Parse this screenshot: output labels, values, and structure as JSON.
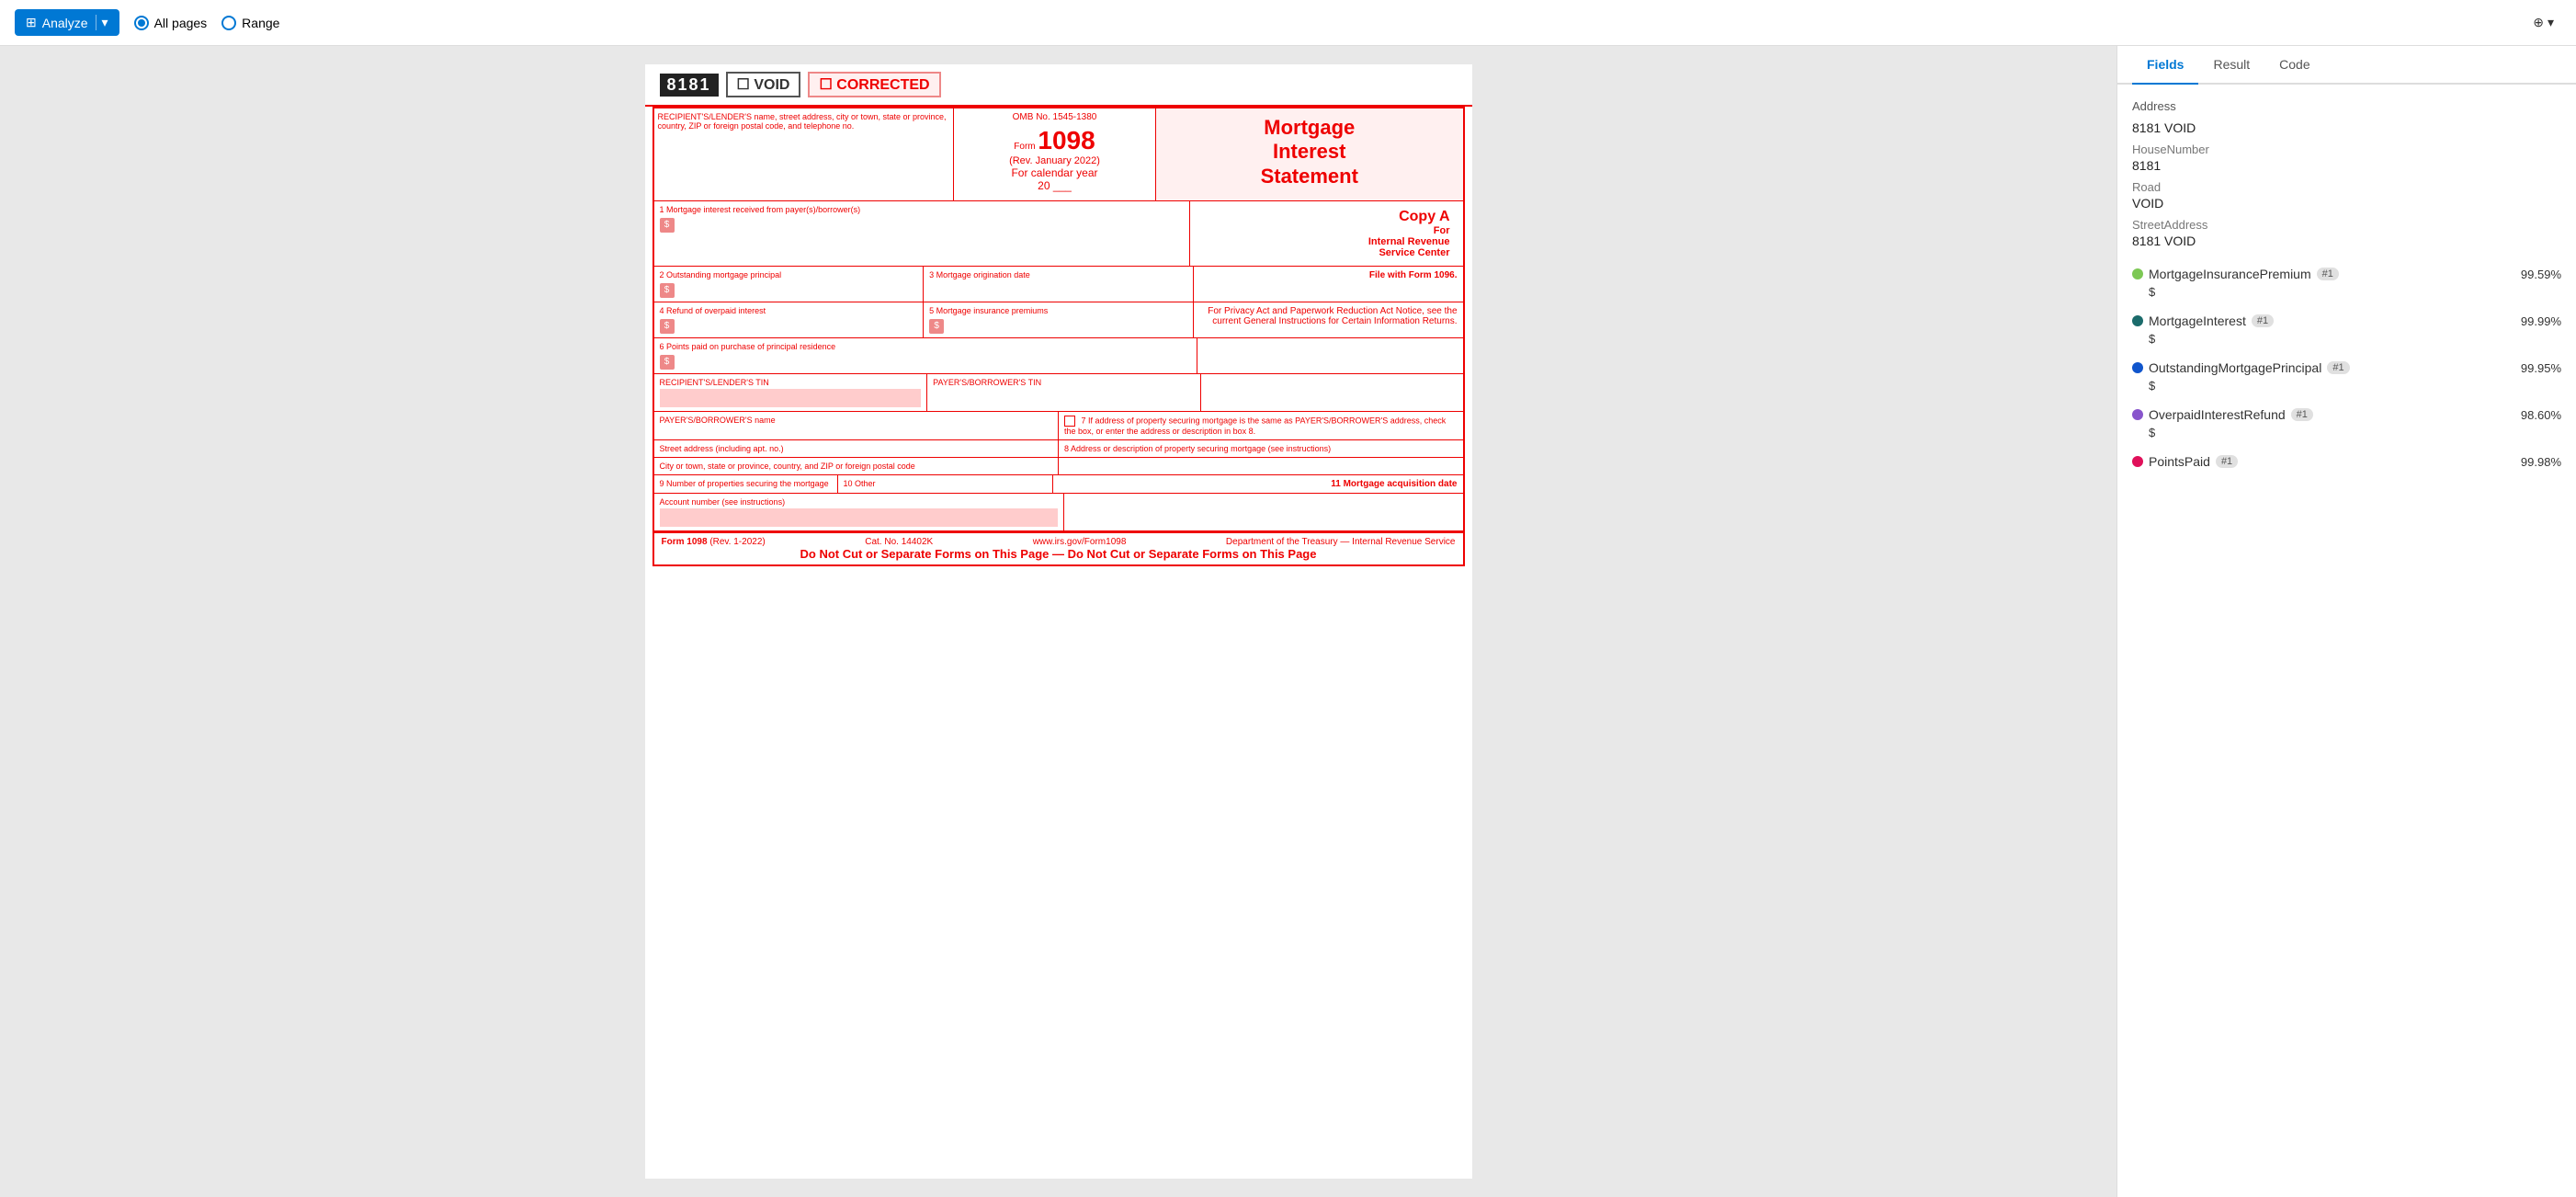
{
  "toolbar": {
    "analyze_label": "Analyze",
    "all_pages_label": "All pages",
    "range_label": "Range",
    "layers_label": "⊕"
  },
  "panel": {
    "tabs": [
      "Fields",
      "Result",
      "Code"
    ],
    "active_tab": "Fields",
    "address_section_label": "Address",
    "address_fields": [
      {
        "label": "8181 VOID"
      },
      {
        "sub_label": "HouseNumber",
        "value": "8181"
      },
      {
        "sub_label": "Road",
        "value": "VOID"
      },
      {
        "sub_label": "StreetAddress",
        "value": "8181 VOID"
      }
    ],
    "fields": [
      {
        "name": "MortgageInsurancePremium",
        "badge": "#1",
        "dot_color": "#7dc855",
        "confidence": "99.59%",
        "value": "$"
      },
      {
        "name": "MortgageInterest",
        "badge": "#1",
        "dot_color": "#1b6b6b",
        "confidence": "99.99%",
        "value": "$"
      },
      {
        "name": "OutstandingMortgagePrincipal",
        "badge": "#1",
        "dot_color": "#1055cc",
        "confidence": "99.95%",
        "value": "$"
      },
      {
        "name": "OverpaidInterestRefund",
        "badge": "#1",
        "dot_color": "#8855cc",
        "confidence": "98.60%",
        "value": "$"
      },
      {
        "name": "PointsPaid",
        "badge": "#1",
        "dot_color": "#e0105a",
        "confidence": "99.98%",
        "value": ""
      }
    ]
  },
  "form": {
    "form_number_box": "8181",
    "void_label": "VOID",
    "corrected_label": "CORRECTED",
    "omb": "OMB No. 1545-1380",
    "form_name": "1098",
    "rev": "(Rev. January 2022)",
    "calendar_label": "For calendar year",
    "calendar_year": "20 ___",
    "title_line1": "Mortgage",
    "title_line2": "Interest",
    "title_line3": "Statement",
    "copy_a_label": "Copy A",
    "copy_a_sub": "For",
    "copy_a_irs": "Internal Revenue",
    "copy_a_sc": "Service Center",
    "file_with": "File with Form 1096.",
    "privacy_text": "For Privacy Act and Paperwork Reduction Act Notice, see the current General Instructions for Certain Information Returns.",
    "recipient_label": "RECIPIENT'S/LENDER'S name, street address, city or town, state or province, country, ZIP or foreign postal code, and telephone no.",
    "box1_label": "1 Mortgage interest received from payer(s)/borrower(s)",
    "box2_label": "2 Outstanding mortgage principal",
    "box3_label": "3 Mortgage origination date",
    "box4_label": "4 Refund of overpaid interest",
    "box5_label": "5 Mortgage insurance premiums",
    "box6_label": "6 Points paid on purchase of principal residence",
    "box7_label": "7",
    "box7_text": "If address of property securing mortgage is the same as PAYER'S/BORROWER'S address, check the box, or enter the address or description in box 8.",
    "box8_label": "8 Address or description of property securing mortgage (see instructions)",
    "box9_label": "9 Number of properties securing the mortgage",
    "box10_label": "10 Other",
    "box11_label": "11 Mortgage acquisition date",
    "account_label": "Account number (see instructions)",
    "recipient_tin_label": "RECIPIENT'S/LENDER'S TIN",
    "borrower_tin_label": "PAYER'S/BORROWER'S TIN",
    "borrower_name_label": "PAYER'S/BORROWER'S name",
    "street_label": "Street address (including apt. no.)",
    "city_label": "City or town, state or province, country, and ZIP or foreign postal code",
    "footer_form": "Form 1098",
    "footer_rev": "(Rev. 1-2022)",
    "footer_cat": "Cat. No. 14402K",
    "footer_url": "www.irs.gov/Form1098",
    "footer_dept": "Department of the Treasury — Internal Revenue Service",
    "footer_note": "Do Not Cut or Separate Forms on This Page — Do Not Cut or Separate Forms on This Page"
  }
}
